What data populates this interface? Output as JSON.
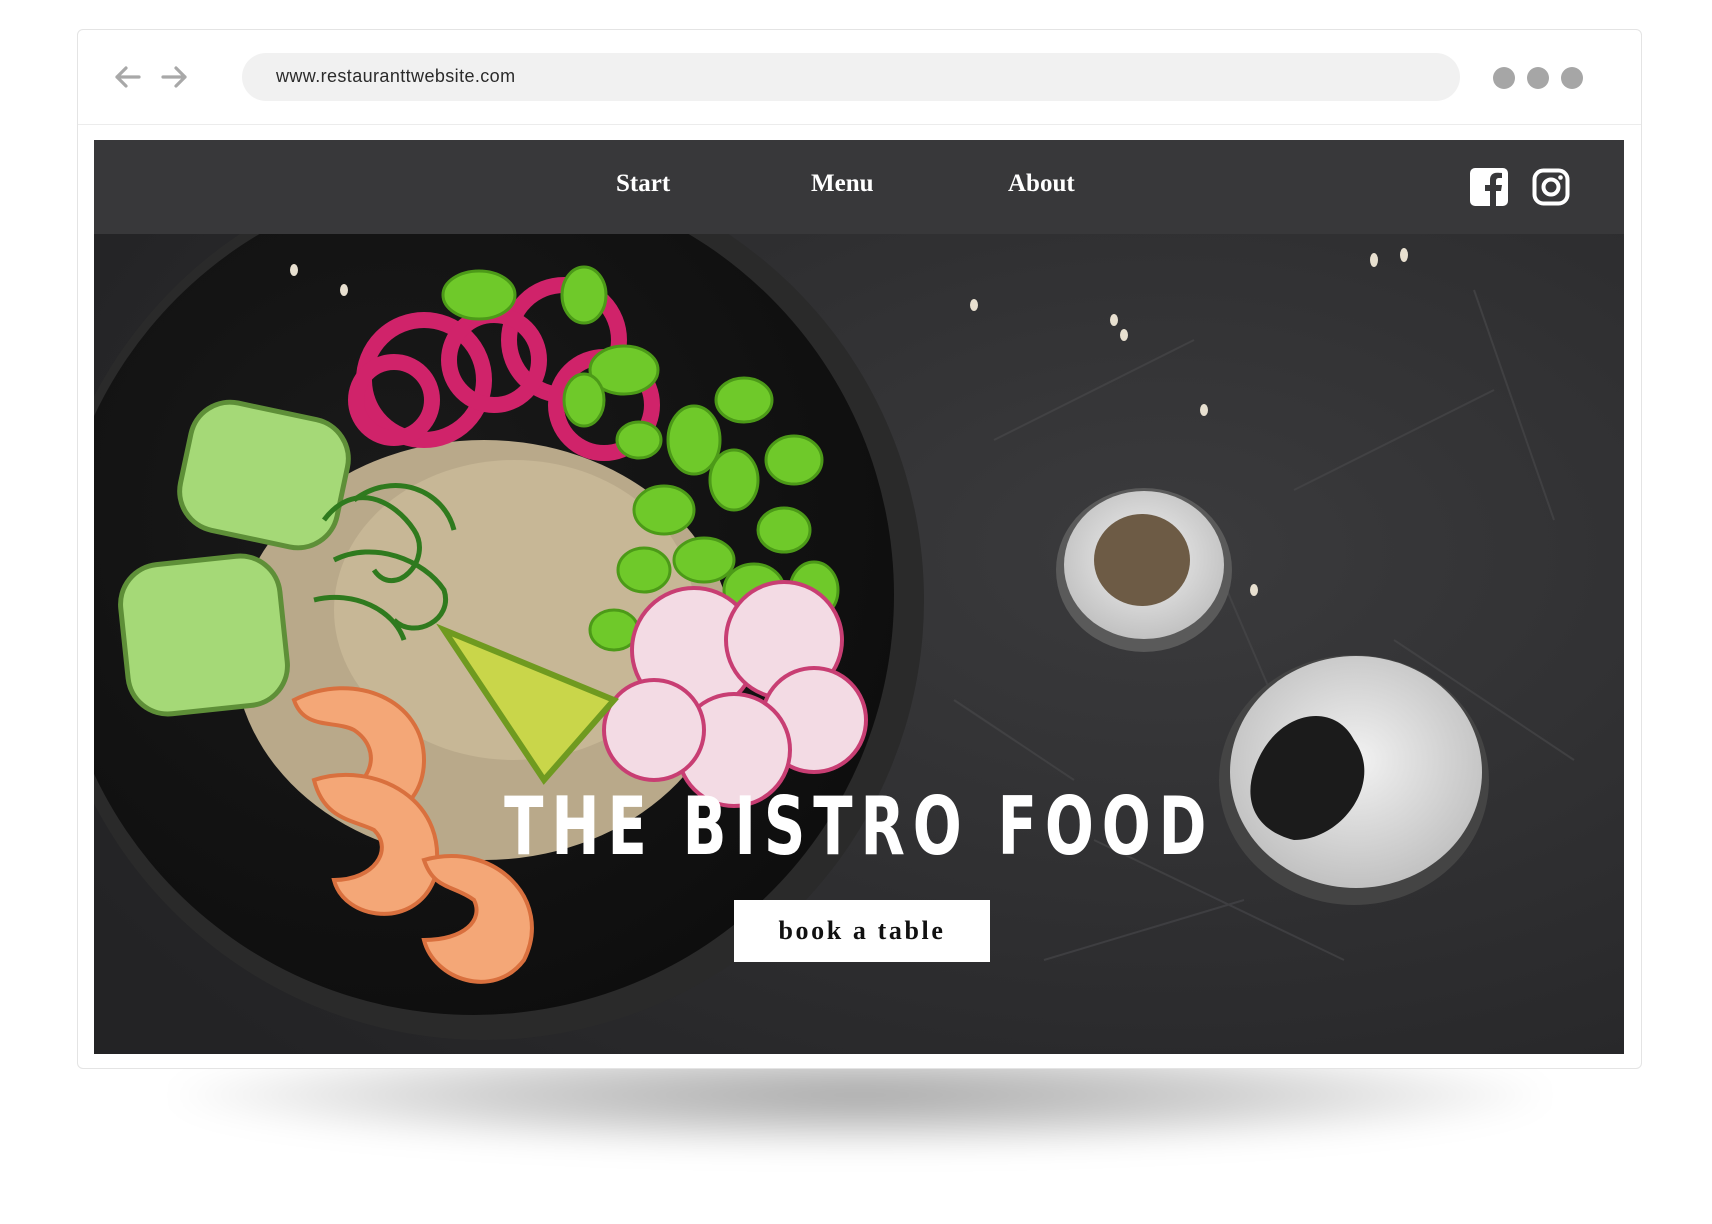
{
  "browser": {
    "url": "www.restauranttwebsite.com",
    "back_icon": "arrow-left-icon",
    "forward_icon": "arrow-right-icon",
    "menu_icon": "three-dots-icon"
  },
  "site": {
    "nav": {
      "items": [
        {
          "label": "Start"
        },
        {
          "label": "Menu"
        },
        {
          "label": "About"
        }
      ],
      "social": [
        {
          "icon": "facebook-icon"
        },
        {
          "icon": "instagram-icon"
        }
      ]
    },
    "hero": {
      "title": "THE BISTRO FOOD",
      "cta_label": "book a table",
      "background": "food-bowl-photo"
    }
  },
  "colors": {
    "nav_bar": "#38383a",
    "hero_background": "#2c2c2e",
    "button": "#ffffff",
    "text_light": "#ffffff"
  }
}
